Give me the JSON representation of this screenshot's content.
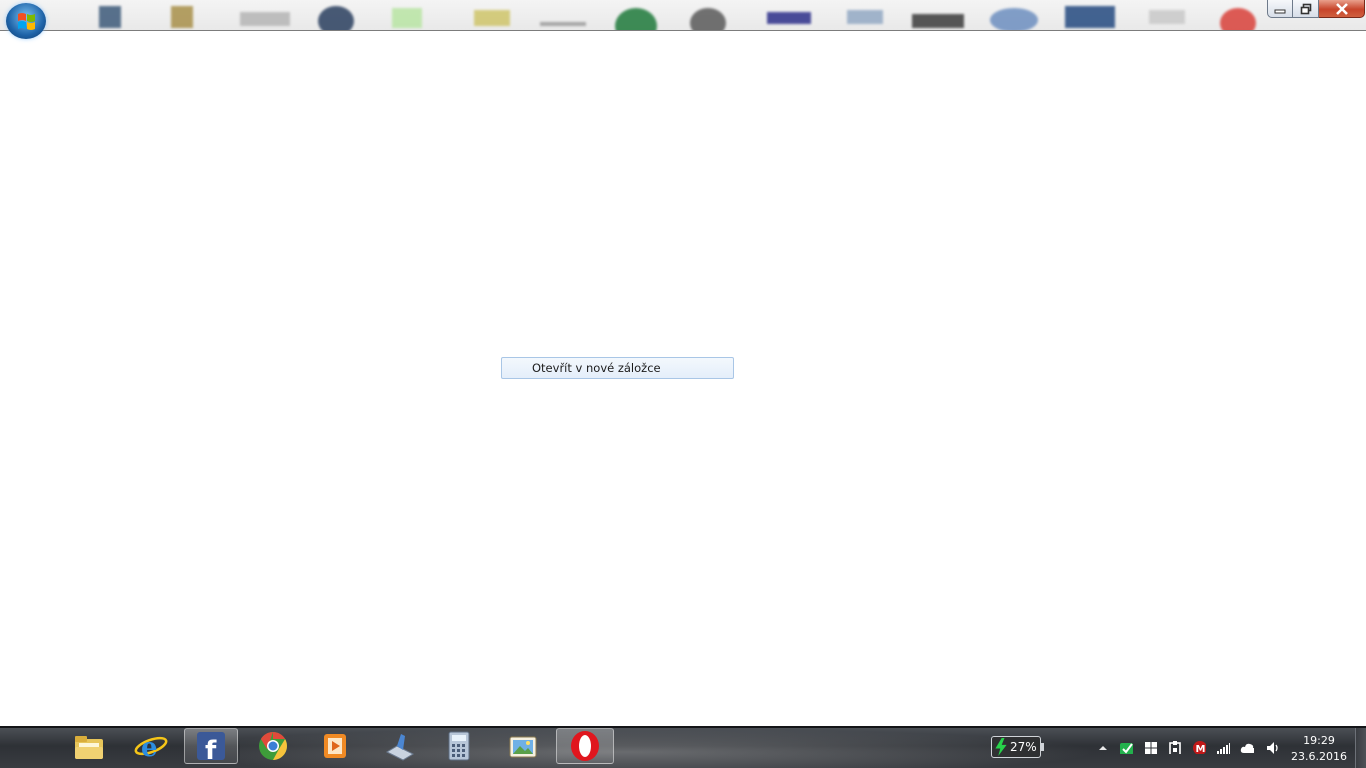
{
  "context_menu": {
    "item_label": "Otevřít v nové záložce"
  },
  "window_controls": {
    "minimize_icon": "minimize-icon",
    "maximize_icon": "restore-icon",
    "close_icon": "close-icon"
  },
  "taskbar": {
    "start_icon": "windows-start-icon",
    "pinned": [
      {
        "name": "file-explorer-icon",
        "active": false
      },
      {
        "name": "internet-explorer-icon",
        "active": false
      },
      {
        "name": "facebook-icon",
        "active": true
      },
      {
        "name": "chrome-icon",
        "active": false
      },
      {
        "name": "media-player-icon",
        "active": false
      },
      {
        "name": "scanner-icon",
        "active": false
      },
      {
        "name": "calculator-icon",
        "active": false
      },
      {
        "name": "photo-viewer-icon",
        "active": false
      },
      {
        "name": "opera-icon",
        "active": true
      }
    ],
    "battery": {
      "percent_label": "27%",
      "charging": true
    },
    "tray_icons": [
      "show-hidden-icons-arrow",
      "security-check-icon",
      "windows-flag-icon",
      "device-icon",
      "mcafee-icon",
      "signal-icon",
      "cloud-icon",
      "volume-icon"
    ],
    "clock": {
      "time": "19:29",
      "date": "23.6.2016"
    }
  },
  "colors": {
    "taskbar": "#2e3136",
    "menu_highlight_border": "#a9c6e6",
    "battery_bolt": "#27d24a"
  }
}
